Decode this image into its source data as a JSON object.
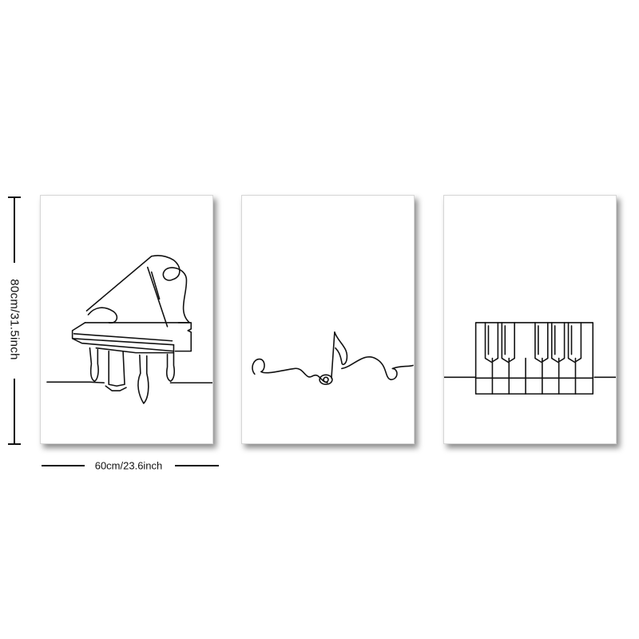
{
  "dimensions": {
    "height_text": "80cm/31.5inch",
    "width_text": "60cm/23.6inch"
  },
  "panels": [
    {
      "subject": "grand-piano-line-art"
    },
    {
      "subject": "music-note-line-art"
    },
    {
      "subject": "piano-keys-line-art"
    }
  ],
  "colors": {
    "background": "#ffffff",
    "line": "#111111"
  }
}
